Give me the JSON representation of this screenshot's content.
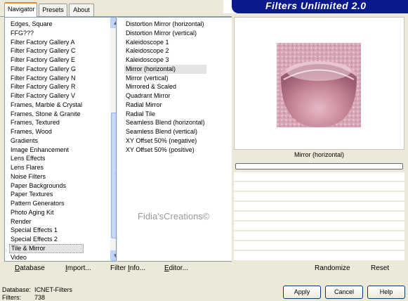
{
  "banner": {
    "title": "Filters Unlimited 2.0"
  },
  "tabs": [
    "Navigator",
    "Presets",
    "About"
  ],
  "categories": [
    "Edges, Square",
    "FFG???",
    "Filter Factory Gallery A",
    "Filter Factory Gallery C",
    "Filter Factory Gallery E",
    "Filter Factory Gallery G",
    "Filter Factory Gallery N",
    "Filter Factory Gallery R",
    "Filter Factory Gallery V",
    "Frames, Marble & Crystal",
    "Frames, Stone & Granite",
    "Frames, Textured",
    "Frames, Wood",
    "Gradients",
    "Image Enhancement",
    "Lens Effects",
    "Lens Flares",
    "Noise Filters",
    "Paper Backgrounds",
    "Paper Textures",
    "Pattern Generators",
    "Photo Aging Kit",
    "Render",
    "Special Effects 1",
    "Special Effects 2",
    "Tile & Mirror",
    "Video"
  ],
  "selected_category": "Tile & Mirror",
  "filters": [
    "Distortion Mirror (horizontal)",
    "Distortion Mirror (vertical)",
    "Kaleidoscope 1",
    "Kaleidoscope 2",
    "Kaleidoscope 3",
    "Mirror (horizontal)",
    "Mirror (vertical)",
    "Mirrored & Scaled",
    "Quadrant Mirror",
    "Radial Mirror",
    "Radial Tile",
    "Seamless Blend (horizontal)",
    "Seamless Blend (vertical)",
    "XY Offset 50% (negative)",
    "XY Offset 50% (positive)"
  ],
  "selected_filter": "Mirror (horizontal)",
  "watermark": "Fidia'sCreations©",
  "preview": {
    "caption": "Mirror (horizontal)"
  },
  "toolbar": {
    "database": {
      "first": "D",
      "rest": "atabase"
    },
    "import": {
      "first": "I",
      "rest": "mport..."
    },
    "filter_info": {
      "pre": "Filter ",
      "first": "I",
      "rest": "nfo..."
    },
    "editor": {
      "first": "E",
      "rest": "ditor..."
    },
    "randomize": "Randomize",
    "reset": "Reset"
  },
  "status": {
    "database_label": "Database:",
    "database_value": "ICNET-Filters",
    "filters_label": "Filters:",
    "filters_value": "738"
  },
  "buttons": {
    "apply": "Apply",
    "cancel": "Cancel",
    "help": "Help"
  },
  "colors": {
    "banner": "#0a1a8c",
    "selection": "#e4e4e4",
    "preview_pink": "#c98aa0"
  }
}
